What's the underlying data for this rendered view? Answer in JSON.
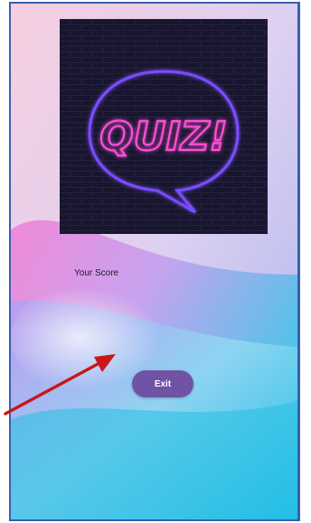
{
  "quiz_image": {
    "text": "QUIZ!"
  },
  "score": {
    "label": "Your Score"
  },
  "exit_button": {
    "label": "Exit"
  },
  "colors": {
    "frame_border": "#3a5fb0",
    "exit_button": "#7053a4",
    "annotation_arrow": "#c8161b",
    "neon_bubble": "#7a4dff"
  }
}
